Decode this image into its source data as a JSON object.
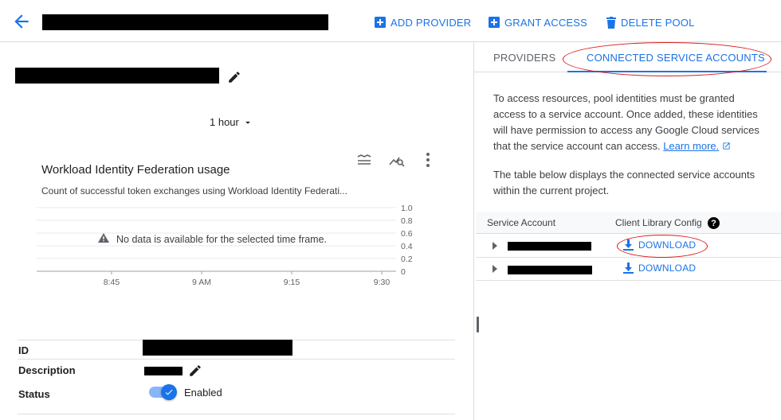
{
  "toolbar": {
    "add_provider": "ADD PROVIDER",
    "grant_access": "GRANT ACCESS",
    "delete_pool": "DELETE POOL"
  },
  "time_range": {
    "selected": "1 hour"
  },
  "chart_card": {
    "title": "Workload Identity Federation usage",
    "subtitle": "Count of successful token exchanges using Workload Identity Federati...",
    "empty_message": "No data is available for the selected time frame."
  },
  "chart_data": {
    "type": "line",
    "title": "Workload Identity Federation usage",
    "x_ticks": [
      "8:45",
      "9 AM",
      "9:15",
      "9:30"
    ],
    "y_ticks": [
      "1.0",
      "0.8",
      "0.6",
      "0.4",
      "0.2",
      "0"
    ],
    "ylim": [
      0,
      1.0
    ],
    "series": [],
    "grid": true
  },
  "details": {
    "id_label": "ID",
    "description_label": "Description",
    "status_label": "Status",
    "status_value": "Enabled"
  },
  "tabs": {
    "providers": "PROVIDERS",
    "connected": "CONNECTED SERVICE ACCOUNTS"
  },
  "info": {
    "para1": "To access resources, pool identities must be granted access to a service account. Once added, these identities will have permission to access any Google Cloud services that the service account can access.",
    "learn_more": "Learn more.",
    "para2": "The table below displays the connected service accounts within the current project."
  },
  "table": {
    "col_account": "Service Account",
    "col_config": "Client Library Config",
    "help_glyph": "?",
    "rows": [
      {
        "download": "DOWNLOAD"
      },
      {
        "download": "DOWNLOAD"
      }
    ]
  },
  "colors": {
    "accent": "#1a73e8",
    "annotation": "#d81b1b"
  }
}
